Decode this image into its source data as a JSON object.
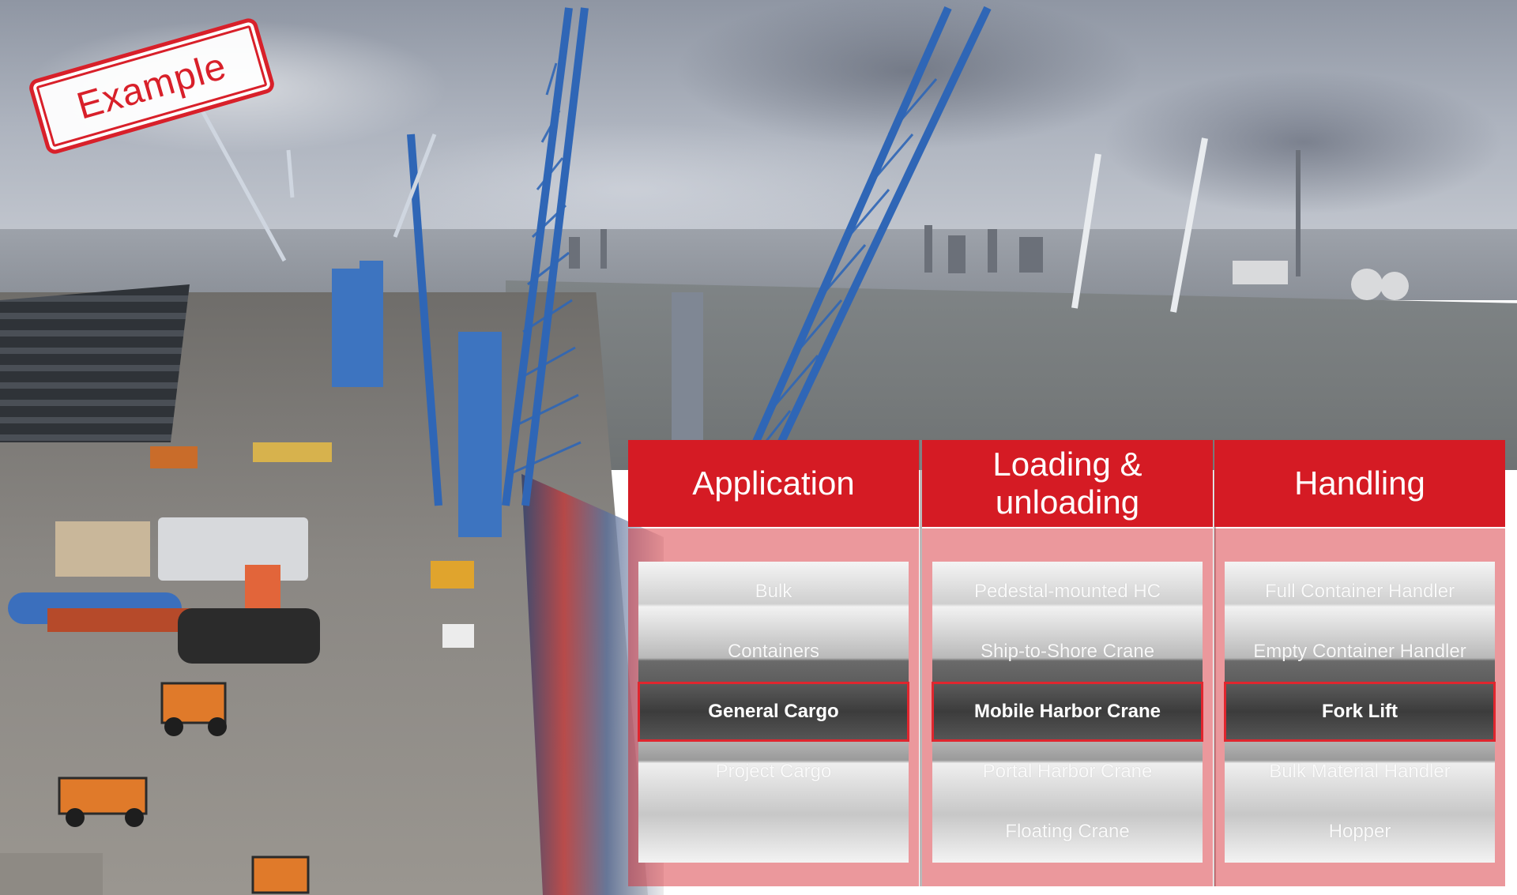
{
  "stamp": {
    "label": "Example"
  },
  "columns": [
    {
      "title": "Application",
      "items": [
        "Bulk",
        "Containers",
        "General Cargo",
        "Project Cargo",
        ""
      ],
      "selected": "General Cargo"
    },
    {
      "title": "Loading & unloading",
      "items": [
        "Pedestal-mounted HC",
        "Ship-to-Shore Crane",
        "Mobile Harbor Crane",
        "Portal Harbor Crane",
        "Floating Crane"
      ],
      "selected": "Mobile Harbor Crane"
    },
    {
      "title": "Handling",
      "items": [
        "Full Container Handler",
        "Empty Container Handler",
        "Fork Lift",
        "Bulk Material Handler",
        "Hopper"
      ],
      "selected": "Fork Lift"
    }
  ],
  "colors": {
    "accent": "#d51b24",
    "selection_border": "#e0262e"
  }
}
